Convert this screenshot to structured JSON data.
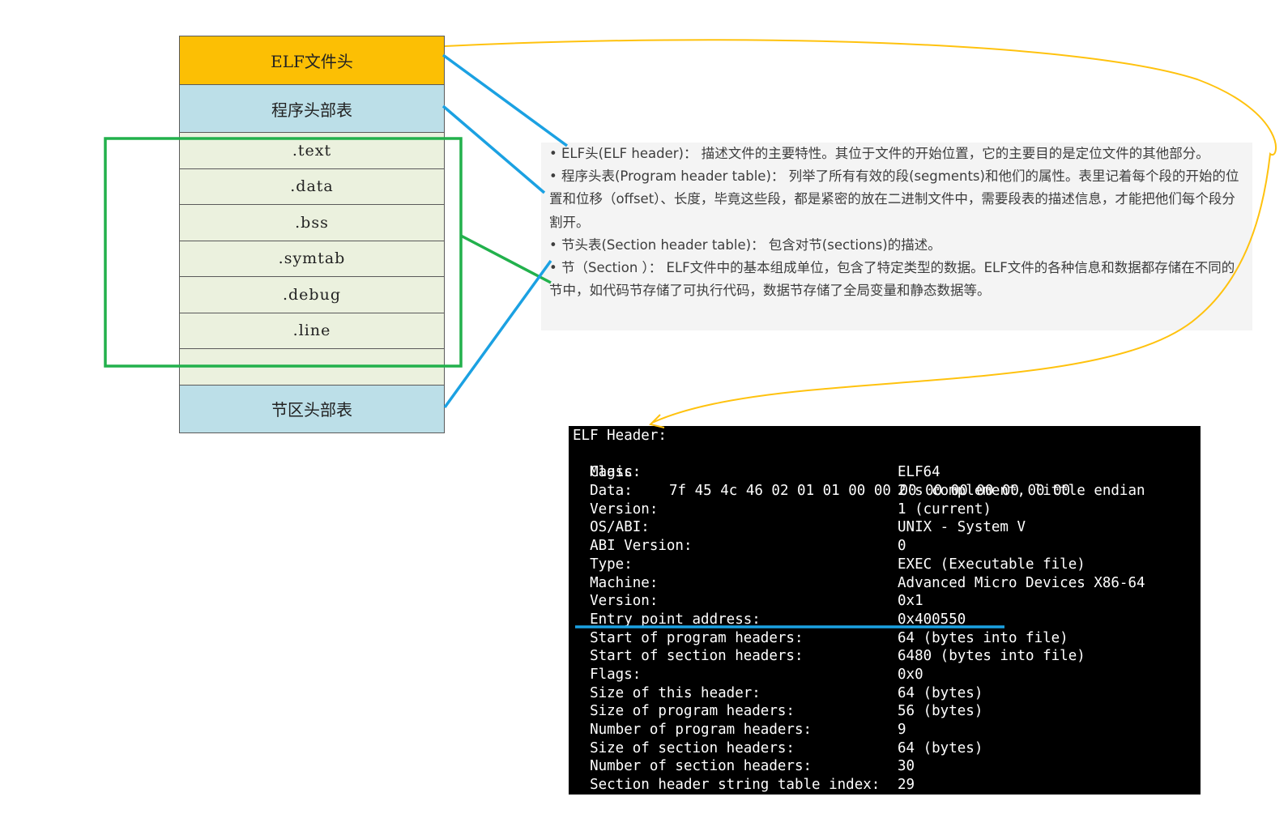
{
  "elf_layout": {
    "elf_header": "ELF文件头",
    "program_header_table": "程序头部表",
    "sections": [
      ".text",
      ".data",
      ".bss",
      ".symtab",
      ".debug",
      ".line",
      ""
    ],
    "section_header_table": "节区头部表"
  },
  "description": [
    "• ELF头(ELF header)：  描述文件的主要特性。其位于文件的开始位置，它的主要目的是定位文件的其他部分。",
    "• 程序头表(Program header table)：  列举了所有有效的段(segments)和他们的属性。表里记着每个段的开始的位置和位移（offset）、长度，毕竟这些段，都是紧密的放在二进制文件中，需要段表的描述信息，才能把他们每个段分割开。",
    "• 节头表(Section header table)：  包含对节(sections)的描述。",
    "• 节（Section ）：  ELF文件中的基本组成单位，包含了特定类型的数据。ELF文件的各种信息和数据都存储在不同的节中，如代码节存储了可执行代码，数据节存储了全局变量和静态数据等。"
  ],
  "terminal": {
    "title": "ELF Header:",
    "magic_label": "Magic:",
    "magic_value": "7f 45 4c 46 02 01 01 00 00 00 00 00 00 00 00 00",
    "fields": [
      {
        "label": "Class:",
        "value": "ELF64"
      },
      {
        "label": "Data:",
        "value": "2's complement, little endian"
      },
      {
        "label": "Version:",
        "value": "1 (current)"
      },
      {
        "label": "OS/ABI:",
        "value": "UNIX - System V"
      },
      {
        "label": "ABI Version:",
        "value": "0"
      },
      {
        "label": "Type:",
        "value": "EXEC (Executable file)"
      },
      {
        "label": "Machine:",
        "value": "Advanced Micro Devices X86-64"
      },
      {
        "label": "Version:",
        "value": "0x1"
      },
      {
        "label": "Entry point address:",
        "value": "0x400550"
      },
      {
        "label": "Start of program headers:",
        "value": "64 (bytes into file)"
      },
      {
        "label": "Start of section headers:",
        "value": "6480 (bytes into file)"
      },
      {
        "label": "Flags:",
        "value": "0x0"
      },
      {
        "label": "Size of this header:",
        "value": "64 (bytes)"
      },
      {
        "label": "Size of program headers:",
        "value": "56 (bytes)"
      },
      {
        "label": "Number of program headers:",
        "value": "9"
      },
      {
        "label": "Size of section headers:",
        "value": "64 (bytes)"
      },
      {
        "label": "Number of section headers:",
        "value": "30"
      },
      {
        "label": "Section header string table index:",
        "value": "29"
      }
    ]
  },
  "colors": {
    "elf_header_fill": "#fcbf04",
    "table_fill": "#bcdfe8",
    "section_fill": "#ebf1de",
    "connector_blue": "#1ba1e2",
    "group_green": "#22b14c",
    "curve_yellow": "#ffc20e"
  }
}
